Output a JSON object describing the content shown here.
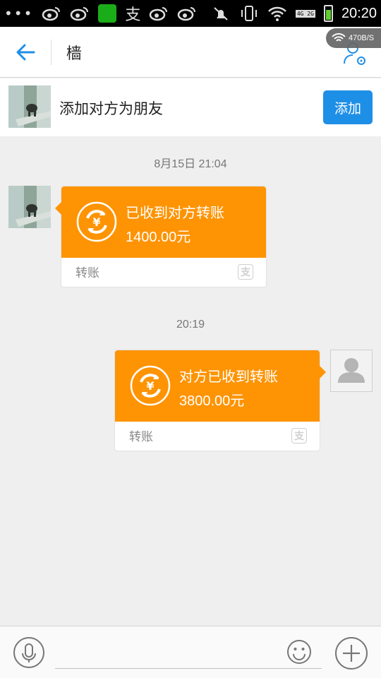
{
  "status_bar": {
    "time": "20:20",
    "signal_text": "4G 2G",
    "icons": [
      "more-dots-icon",
      "weibo-icon",
      "weibo-icon",
      "wechat-icon",
      "alipay-icon",
      "weibo-icon",
      "weibo-icon",
      "mute-icon",
      "vibrate-icon",
      "wifi-icon",
      "signal-icon",
      "battery-icon"
    ],
    "alipay_glyph": "支"
  },
  "header": {
    "title": "樯",
    "network_speed": "470B/S"
  },
  "add_friend": {
    "prompt": "添加对方为朋友",
    "button_label": "添加"
  },
  "messages": [
    {
      "timestamp": "8月15日 21:04",
      "direction": "incoming",
      "title": "已收到对方转账",
      "amount": "1400.00元",
      "footer": "转账",
      "logo_glyph": "支"
    },
    {
      "timestamp": "20:19",
      "direction": "outgoing",
      "title": "对方已收到转账",
      "amount": "3800.00元",
      "footer": "转账",
      "logo_glyph": "支"
    }
  ],
  "input_bar": {
    "placeholder": ""
  },
  "colors": {
    "accent_blue": "#1e8fe6",
    "transfer_orange": "#fe9404",
    "background": "#efefef"
  }
}
